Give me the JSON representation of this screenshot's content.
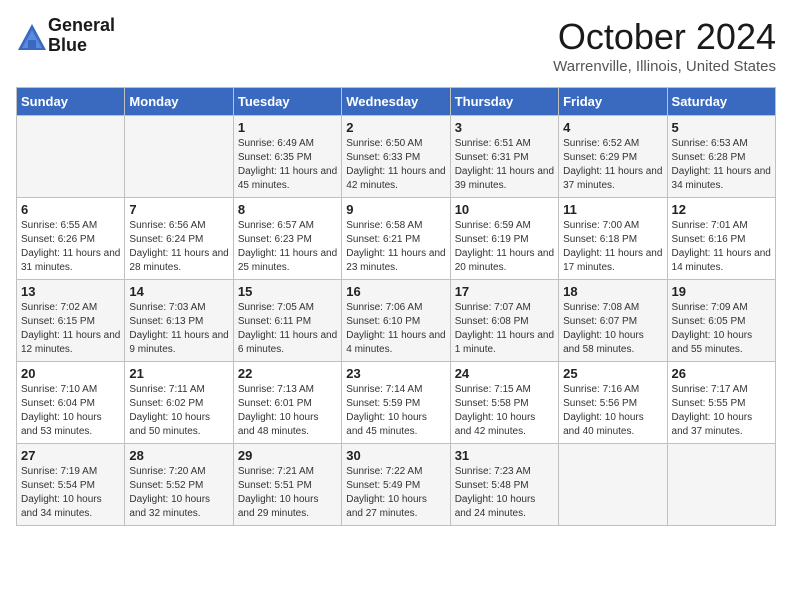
{
  "header": {
    "logo_line1": "General",
    "logo_line2": "Blue",
    "month": "October 2024",
    "location": "Warrenville, Illinois, United States"
  },
  "days_of_week": [
    "Sunday",
    "Monday",
    "Tuesday",
    "Wednesday",
    "Thursday",
    "Friday",
    "Saturday"
  ],
  "weeks": [
    [
      {
        "day": "",
        "data": ""
      },
      {
        "day": "",
        "data": ""
      },
      {
        "day": "1",
        "data": "Sunrise: 6:49 AM\nSunset: 6:35 PM\nDaylight: 11 hours and 45 minutes."
      },
      {
        "day": "2",
        "data": "Sunrise: 6:50 AM\nSunset: 6:33 PM\nDaylight: 11 hours and 42 minutes."
      },
      {
        "day": "3",
        "data": "Sunrise: 6:51 AM\nSunset: 6:31 PM\nDaylight: 11 hours and 39 minutes."
      },
      {
        "day": "4",
        "data": "Sunrise: 6:52 AM\nSunset: 6:29 PM\nDaylight: 11 hours and 37 minutes."
      },
      {
        "day": "5",
        "data": "Sunrise: 6:53 AM\nSunset: 6:28 PM\nDaylight: 11 hours and 34 minutes."
      }
    ],
    [
      {
        "day": "6",
        "data": "Sunrise: 6:55 AM\nSunset: 6:26 PM\nDaylight: 11 hours and 31 minutes."
      },
      {
        "day": "7",
        "data": "Sunrise: 6:56 AM\nSunset: 6:24 PM\nDaylight: 11 hours and 28 minutes."
      },
      {
        "day": "8",
        "data": "Sunrise: 6:57 AM\nSunset: 6:23 PM\nDaylight: 11 hours and 25 minutes."
      },
      {
        "day": "9",
        "data": "Sunrise: 6:58 AM\nSunset: 6:21 PM\nDaylight: 11 hours and 23 minutes."
      },
      {
        "day": "10",
        "data": "Sunrise: 6:59 AM\nSunset: 6:19 PM\nDaylight: 11 hours and 20 minutes."
      },
      {
        "day": "11",
        "data": "Sunrise: 7:00 AM\nSunset: 6:18 PM\nDaylight: 11 hours and 17 minutes."
      },
      {
        "day": "12",
        "data": "Sunrise: 7:01 AM\nSunset: 6:16 PM\nDaylight: 11 hours and 14 minutes."
      }
    ],
    [
      {
        "day": "13",
        "data": "Sunrise: 7:02 AM\nSunset: 6:15 PM\nDaylight: 11 hours and 12 minutes."
      },
      {
        "day": "14",
        "data": "Sunrise: 7:03 AM\nSunset: 6:13 PM\nDaylight: 11 hours and 9 minutes."
      },
      {
        "day": "15",
        "data": "Sunrise: 7:05 AM\nSunset: 6:11 PM\nDaylight: 11 hours and 6 minutes."
      },
      {
        "day": "16",
        "data": "Sunrise: 7:06 AM\nSunset: 6:10 PM\nDaylight: 11 hours and 4 minutes."
      },
      {
        "day": "17",
        "data": "Sunrise: 7:07 AM\nSunset: 6:08 PM\nDaylight: 11 hours and 1 minute."
      },
      {
        "day": "18",
        "data": "Sunrise: 7:08 AM\nSunset: 6:07 PM\nDaylight: 10 hours and 58 minutes."
      },
      {
        "day": "19",
        "data": "Sunrise: 7:09 AM\nSunset: 6:05 PM\nDaylight: 10 hours and 55 minutes."
      }
    ],
    [
      {
        "day": "20",
        "data": "Sunrise: 7:10 AM\nSunset: 6:04 PM\nDaylight: 10 hours and 53 minutes."
      },
      {
        "day": "21",
        "data": "Sunrise: 7:11 AM\nSunset: 6:02 PM\nDaylight: 10 hours and 50 minutes."
      },
      {
        "day": "22",
        "data": "Sunrise: 7:13 AM\nSunset: 6:01 PM\nDaylight: 10 hours and 48 minutes."
      },
      {
        "day": "23",
        "data": "Sunrise: 7:14 AM\nSunset: 5:59 PM\nDaylight: 10 hours and 45 minutes."
      },
      {
        "day": "24",
        "data": "Sunrise: 7:15 AM\nSunset: 5:58 PM\nDaylight: 10 hours and 42 minutes."
      },
      {
        "day": "25",
        "data": "Sunrise: 7:16 AM\nSunset: 5:56 PM\nDaylight: 10 hours and 40 minutes."
      },
      {
        "day": "26",
        "data": "Sunrise: 7:17 AM\nSunset: 5:55 PM\nDaylight: 10 hours and 37 minutes."
      }
    ],
    [
      {
        "day": "27",
        "data": "Sunrise: 7:19 AM\nSunset: 5:54 PM\nDaylight: 10 hours and 34 minutes."
      },
      {
        "day": "28",
        "data": "Sunrise: 7:20 AM\nSunset: 5:52 PM\nDaylight: 10 hours and 32 minutes."
      },
      {
        "day": "29",
        "data": "Sunrise: 7:21 AM\nSunset: 5:51 PM\nDaylight: 10 hours and 29 minutes."
      },
      {
        "day": "30",
        "data": "Sunrise: 7:22 AM\nSunset: 5:49 PM\nDaylight: 10 hours and 27 minutes."
      },
      {
        "day": "31",
        "data": "Sunrise: 7:23 AM\nSunset: 5:48 PM\nDaylight: 10 hours and 24 minutes."
      },
      {
        "day": "",
        "data": ""
      },
      {
        "day": "",
        "data": ""
      }
    ]
  ]
}
